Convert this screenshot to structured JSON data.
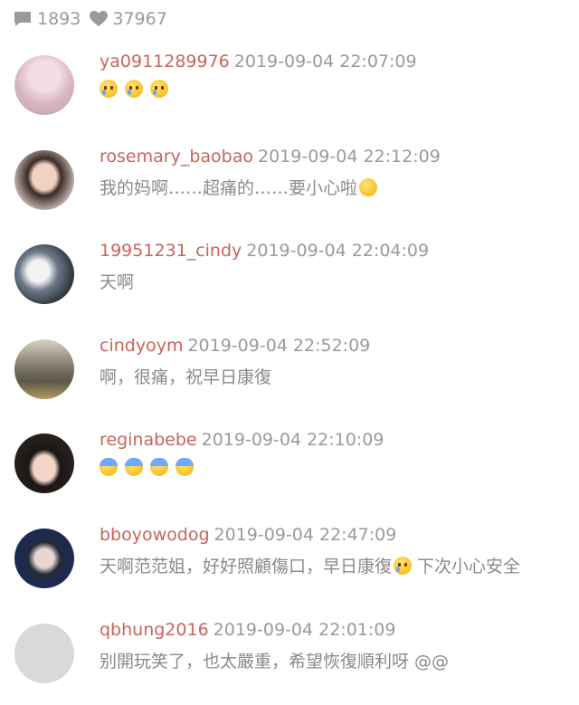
{
  "stats": {
    "comments": "1893",
    "likes": "37967"
  },
  "comments": [
    {
      "username": "ya0911289976",
      "time": "2019-09-04 22:07:09",
      "text": "",
      "emojis": [
        "crying",
        "crying",
        "crying"
      ]
    },
    {
      "username": "rosemary_baobao",
      "time": "2019-09-04 22:12:09",
      "text": "我的妈啊……超痛的……要小心啦",
      "emojis": [
        "pleading"
      ]
    },
    {
      "username": "19951231_cindy",
      "time": "2019-09-04 22:04:09",
      "text": "天啊",
      "emojis": []
    },
    {
      "username": "cindyoym",
      "time": "2019-09-04 22:52:09",
      "text": "啊，很痛，祝早日康復",
      "emojis": []
    },
    {
      "username": "reginabebe",
      "time": "2019-09-04 22:10:09",
      "text": "",
      "emojis": [
        "fearful",
        "screaming",
        "screaming",
        "screaming"
      ]
    },
    {
      "username": "bboyowodog",
      "time": "2019-09-04 22:47:09",
      "text": "天啊范范姐，好好照顧傷口，早日康復",
      "text_after": " 下次小心安全",
      "emojis": [
        "crying"
      ]
    },
    {
      "username": "qbhung2016",
      "time": "2019-09-04 22:01:09",
      "text": "别開玩笑了，也太嚴重，希望恢復順利呀 @@",
      "emojis": []
    }
  ],
  "colors": {
    "username": "#c8655a",
    "meta": "#9a9a9a",
    "text": "#8a8a8a"
  }
}
